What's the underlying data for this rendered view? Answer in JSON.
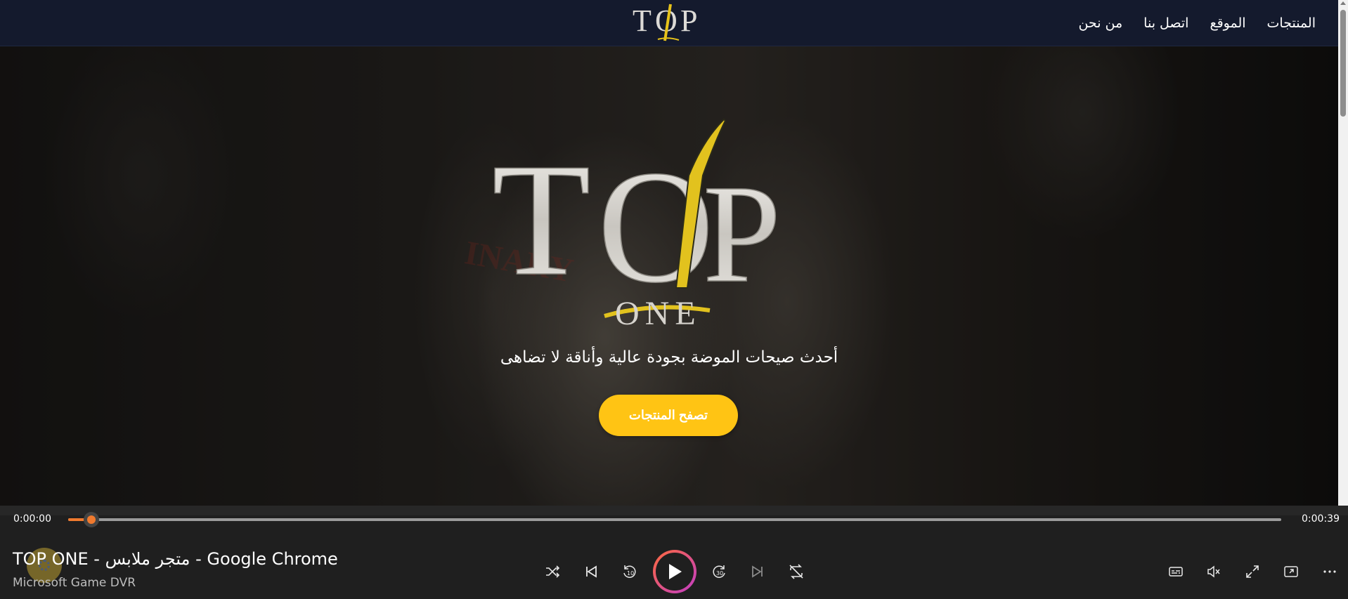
{
  "navbar": {
    "links": [
      "المنتجات",
      "الموقع",
      "اتصل بنا",
      "من نحن"
    ]
  },
  "hero": {
    "tagline": "أحدث صيحات الموضة بجودة عالية وأناقة لا تضاهى",
    "cta_label": "تصفح المنتجات"
  },
  "player": {
    "elapsed": "0:00:00",
    "duration": "0:00:39",
    "progress": 0.0,
    "title": "TOP ONE - متجر ملابس - Google Chrome",
    "subtitle": "Microsoft Game DVR",
    "controls": [
      "shuffle-icon",
      "previous-icon",
      "rewind-10-icon",
      "play-icon",
      "forward-30-icon",
      "next-icon",
      "repeat-off-icon"
    ],
    "right_controls": [
      "captions-icon",
      "mute-icon",
      "fullscreen-icon",
      "mini-player-icon",
      "more-icon"
    ]
  },
  "colors": {
    "navbar_bg": "#141a2d",
    "cta_bg": "#ffc414",
    "player_accent": "#f07a2e"
  }
}
